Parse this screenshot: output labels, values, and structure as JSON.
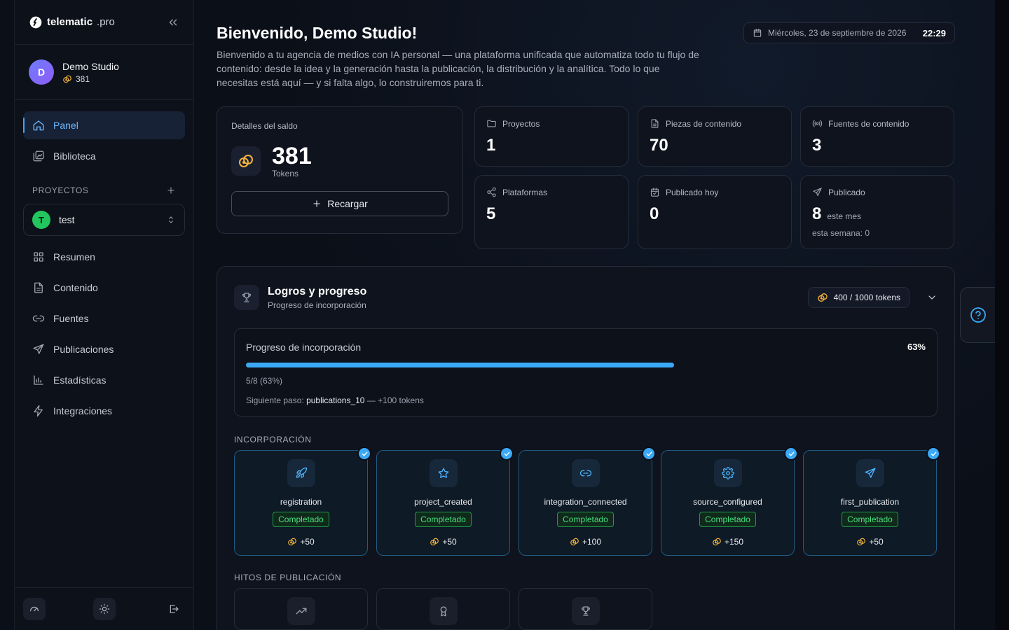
{
  "brand": {
    "name": "telematic",
    "suffix": ".pro"
  },
  "user": {
    "initial": "D",
    "name": "Demo Studio",
    "tokens": "381"
  },
  "nav": {
    "top": [
      {
        "label": "Panel",
        "icon": "home-icon",
        "active": true
      },
      {
        "label": "Biblioteca",
        "icon": "library-icon"
      }
    ],
    "projects_label": "PROYECTOS",
    "project": {
      "initial": "T",
      "name": "test"
    },
    "project_items": [
      {
        "label": "Resumen",
        "icon": "grid-icon"
      },
      {
        "label": "Contenido",
        "icon": "document-icon"
      },
      {
        "label": "Fuentes",
        "icon": "link-icon"
      },
      {
        "label": "Publicaciones",
        "icon": "send-icon"
      },
      {
        "label": "Estadísticas",
        "icon": "bar-chart-icon"
      },
      {
        "label": "Integraciones",
        "icon": "bolt-icon"
      }
    ]
  },
  "header": {
    "title": "Bienvenido, Demo Studio!",
    "subtitle": "Bienvenido a tu agencia de medios con IA personal — una plataforma unificada que automatiza todo tu flujo de contenido: desde la idea y la generación hasta la publicación, la distribución y la analítica. Todo lo que necesitas está aquí — y si falta algo, lo construiremos para ti.",
    "date": "Miércoles, 23 de septiembre de 2026",
    "time": "22:29"
  },
  "balance": {
    "label": "Detalles del saldo",
    "value": "381",
    "unit": "Tokens",
    "recharge_label": "Recargar"
  },
  "stats": {
    "projects": {
      "label": "Proyectos",
      "value": "1"
    },
    "content": {
      "label": "Piezas de contenido",
      "value": "70"
    },
    "sources": {
      "label": "Fuentes de contenido",
      "value": "3"
    },
    "platforms": {
      "label": "Plataformas",
      "value": "5"
    },
    "today": {
      "label": "Publicado hoy",
      "value": "0"
    },
    "published": {
      "label": "Publicado",
      "value": "8",
      "unit": "este mes",
      "week": "esta semana: 0"
    }
  },
  "achievements": {
    "title": "Logros y progreso",
    "subtitle": "Progreso de incorporación",
    "tokens_pill": "400 / 1000 tokens",
    "progress": {
      "label": "Progreso de incorporación",
      "percent_label": "63%",
      "fraction": 0.63,
      "count": "5/8 (63%)",
      "next_prefix": "Siguiente paso:",
      "next_step": "publications_10",
      "next_suffix": "— +100 tokens"
    },
    "onboarding_label": "INCORPORACIÓN",
    "onboarding": [
      {
        "name": "registration",
        "status": "Completado",
        "reward": "+50",
        "icon": "rocket-icon"
      },
      {
        "name": "project_created",
        "status": "Completado",
        "reward": "+50",
        "icon": "star-icon"
      },
      {
        "name": "integration_connected",
        "status": "Completado",
        "reward": "+100",
        "icon": "link-icon"
      },
      {
        "name": "source_configured",
        "status": "Completado",
        "reward": "+150",
        "icon": "gear-icon"
      },
      {
        "name": "first_publication",
        "status": "Completado",
        "reward": "+50",
        "icon": "send-icon"
      }
    ],
    "milestones_label": "HITOS DE PUBLICACIÓN",
    "milestones": [
      {
        "icon": "trending-up-icon"
      },
      {
        "icon": "award-icon"
      },
      {
        "icon": "trophy-icon"
      }
    ]
  },
  "colors": {
    "accent": "#3ba9f5",
    "success": "#4ade80",
    "coin": "#f5b53b"
  }
}
